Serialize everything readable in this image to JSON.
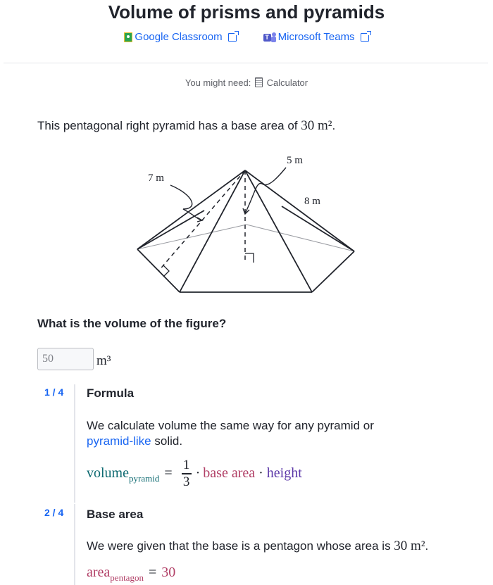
{
  "header": {
    "title": "Volume of prisms and pyramids",
    "google_classroom": "Google Classroom",
    "microsoft_teams": "Microsoft Teams"
  },
  "tools": {
    "need_label": "You might need:",
    "calculator": "Calculator"
  },
  "question": {
    "text": "This pentagonal right pyramid has a base area of ",
    "area_value": "30 m²",
    "period": ".",
    "prompt": "What is the volume of the figure?"
  },
  "figure": {
    "label_slant": "7 m",
    "label_base_edge": "5 m",
    "label_height": "8 m"
  },
  "answer": {
    "value": "50",
    "unit": "m³"
  },
  "steps": [
    {
      "number": "1 / 4",
      "title": "Formula",
      "text_before": "We calculate volume the same way for any pyramid or ",
      "link": "pyramid-like",
      "text_after": " solid.",
      "formula": {
        "lhs": "volume",
        "lhs_sub": "pyramid",
        "equals": "=",
        "numerator": "1",
        "denominator": "3",
        "dot": "·",
        "term1": "base area",
        "term2": "height"
      }
    },
    {
      "number": "2 / 4",
      "title": "Base area",
      "text": "We were given that the base is a pentagon whose area is ",
      "area_value": "30 m²",
      "period": ".",
      "eq_lhs": "area",
      "eq_sub": "pentagon",
      "eq_equals": "=",
      "eq_rhs": "30"
    }
  ],
  "colors": {
    "link": "#1865f2",
    "teal": "#0e6a71",
    "maroon": "#b13f66",
    "purple": "#5c38a8"
  }
}
